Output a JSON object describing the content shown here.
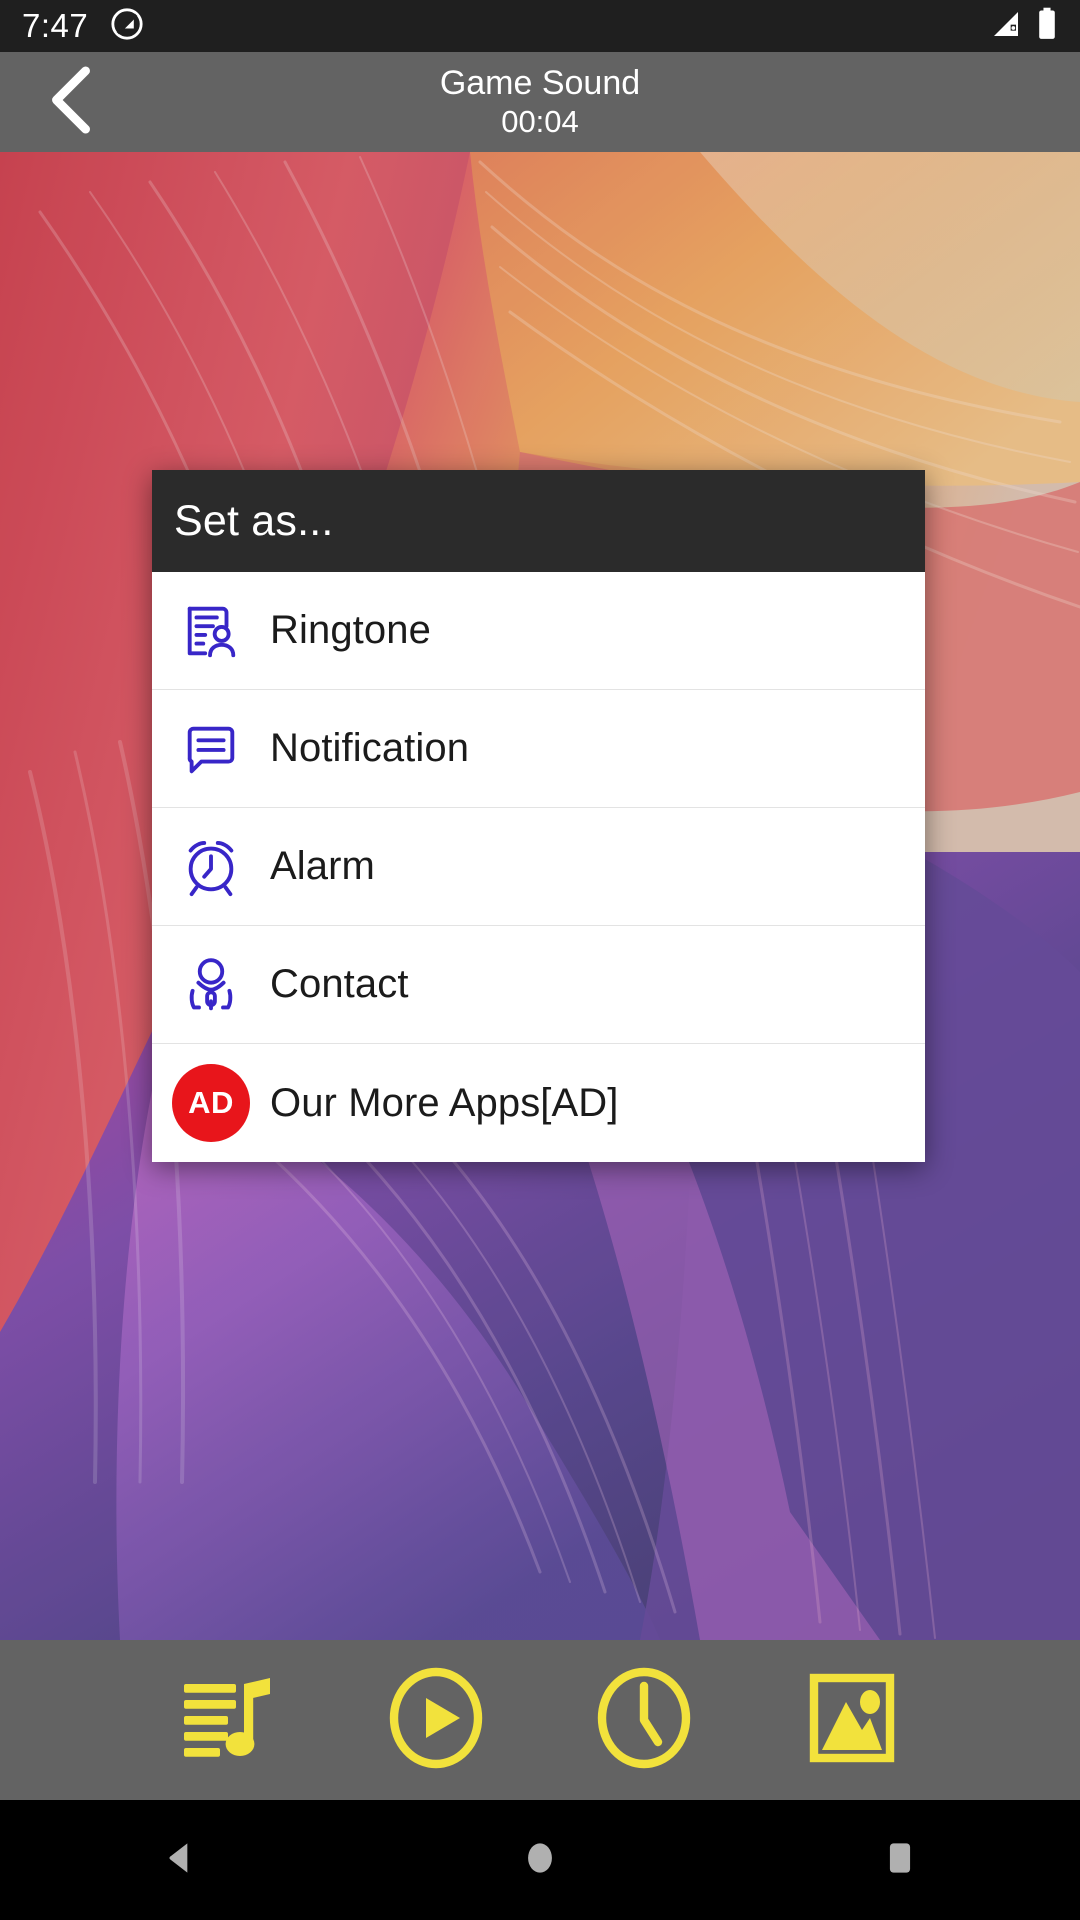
{
  "status_bar": {
    "time": "7:47",
    "icons": [
      "do-not-disturb-icon",
      "signal-icon",
      "battery-icon"
    ],
    "background": "#1f1f1f",
    "text_color": "#ffffff"
  },
  "app_bar": {
    "back_icon": "back-chevron-icon",
    "title": "Game Sound",
    "subtitle": "00:04",
    "background": "#636363",
    "text_color": "#ffffff"
  },
  "wallpaper": {
    "description": "abstract flowing silk gradient",
    "colors": [
      "#d8525e",
      "#e8a05c",
      "#f0d0b0",
      "#b455a8",
      "#6b4d9e",
      "#49406f"
    ]
  },
  "dialog": {
    "title": "Set as...",
    "header_background": "#2b2b2b",
    "header_text_color": "#ffffff",
    "list_background": "#ffffff",
    "icon_color": "#3826c8",
    "items": [
      {
        "label": "Ringtone",
        "icon": "ringtone-contact-card-icon"
      },
      {
        "label": "Notification",
        "icon": "notification-chat-bubble-icon"
      },
      {
        "label": "Alarm",
        "icon": "alarm-clock-icon"
      },
      {
        "label": "Contact",
        "icon": "contact-person-icon"
      },
      {
        "label": "Our More Apps[AD]",
        "icon": "ad-badge-icon",
        "badge_text": "AD",
        "badge_color": "#e8151b"
      }
    ]
  },
  "bottom_toolbar": {
    "background": "#636363",
    "icon_color": "#f2e23c",
    "buttons": [
      {
        "name": "playlist-music-icon"
      },
      {
        "name": "play-circle-icon"
      },
      {
        "name": "clock-icon"
      },
      {
        "name": "gallery-image-icon"
      }
    ]
  },
  "nav_bar": {
    "background": "#000000",
    "icon_color": "#b0b0b0",
    "buttons": [
      {
        "name": "android-back-icon"
      },
      {
        "name": "android-home-icon"
      },
      {
        "name": "android-recents-icon"
      }
    ]
  }
}
